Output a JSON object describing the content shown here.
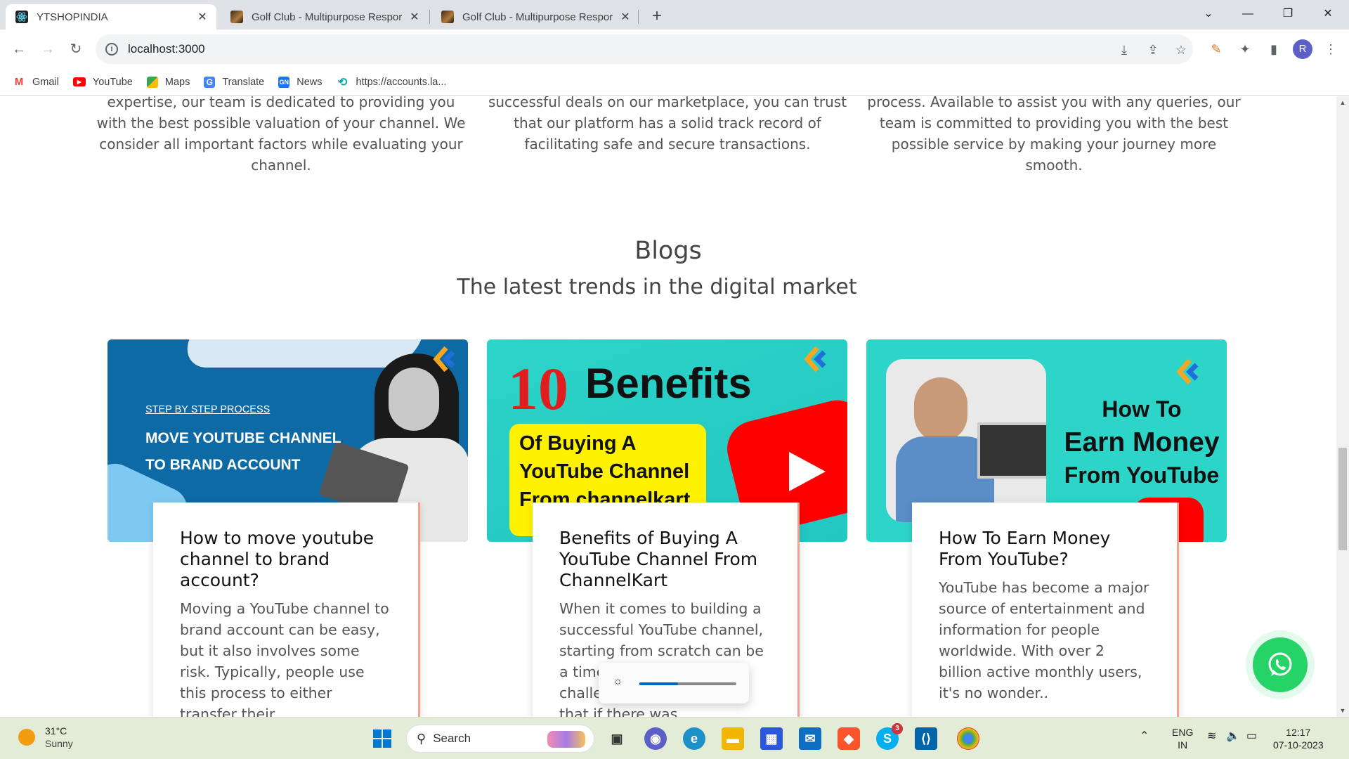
{
  "browser": {
    "tabs": [
      {
        "title": "YTSHOPINDIA",
        "active": true,
        "favicon": "react-icon"
      },
      {
        "title": "Golf Club - Multipurpose Respor",
        "active": false,
        "favicon": "golf-club-icon"
      },
      {
        "title": "Golf Club - Multipurpose Respor",
        "active": false,
        "favicon": "golf-club-icon"
      }
    ],
    "new_tab_label": "+",
    "url": "localhost:3000",
    "profile_initial": "R",
    "bookmarks": [
      {
        "label": "Gmail",
        "icon": "gmail-icon"
      },
      {
        "label": "YouTube",
        "icon": "youtube-icon"
      },
      {
        "label": "Maps",
        "icon": "maps-icon"
      },
      {
        "label": "Translate",
        "icon": "translate-icon"
      },
      {
        "label": "News",
        "icon": "news-icon"
      },
      {
        "label": "https://accounts.la...",
        "icon": "accounts-icon"
      }
    ]
  },
  "page": {
    "features": [
      "expertise, our team is dedicated to providing you with the best possible valuation of your channel. We consider all important factors while evaluating your channel.",
      "successful deals on our marketplace, you can trust that our platform has a solid track record of facilitating safe and secure transactions.",
      "process. Available to assist you with any queries, our team is committed to providing you with the best possible service by making your journey more smooth."
    ],
    "blogs_title": "Blogs",
    "blogs_subtitle": "The latest trends in the digital market",
    "cards": [
      {
        "image": {
          "kicker": "STEP BY STEP PROCESS",
          "line1": "MOVE YOUTUBE CHANNEL",
          "line2": "TO BRAND ACCOUNT"
        },
        "title": "How to move youtube channel to brand account?",
        "excerpt": "Moving a YouTube channel to brand account can be easy, but it also involves some risk. Typically, people use this process to either transfer their"
      },
      {
        "image": {
          "big_number": "10",
          "headline": "Benefits",
          "line1": "Of Buying A",
          "line2": "YouTube Channel",
          "line3": "From channelkart"
        },
        "title": "Benefits of Buying A YouTube Channel From ChannelKart",
        "excerpt": "When it comes to building a successful YouTube channel, starting from scratch can be a time-consuming and challenging process. One that if there was"
      },
      {
        "image": {
          "line1": "How To",
          "line2": "Earn Money",
          "line3": "From YouTube"
        },
        "title": "How To Earn Money From YouTube?",
        "excerpt": "YouTube has become a major source of entertainment and information for people worldwide. With over 2 billion active monthly users, it's no wonder.."
      }
    ]
  },
  "brightness": {
    "level": 0.4
  },
  "taskbar": {
    "weather_temp": "31°C",
    "weather_desc": "Sunny",
    "search_placeholder": "Search",
    "skype_badge": "3",
    "lang_line1": "ENG",
    "lang_line2": "IN",
    "time": "12:17",
    "date": "07-10-2023"
  },
  "colors": {
    "accent_teal": "#2dd4c8",
    "card1_bg": "#0d6aa5",
    "whatsapp": "#25d366",
    "card_border": "#f4a08d"
  }
}
